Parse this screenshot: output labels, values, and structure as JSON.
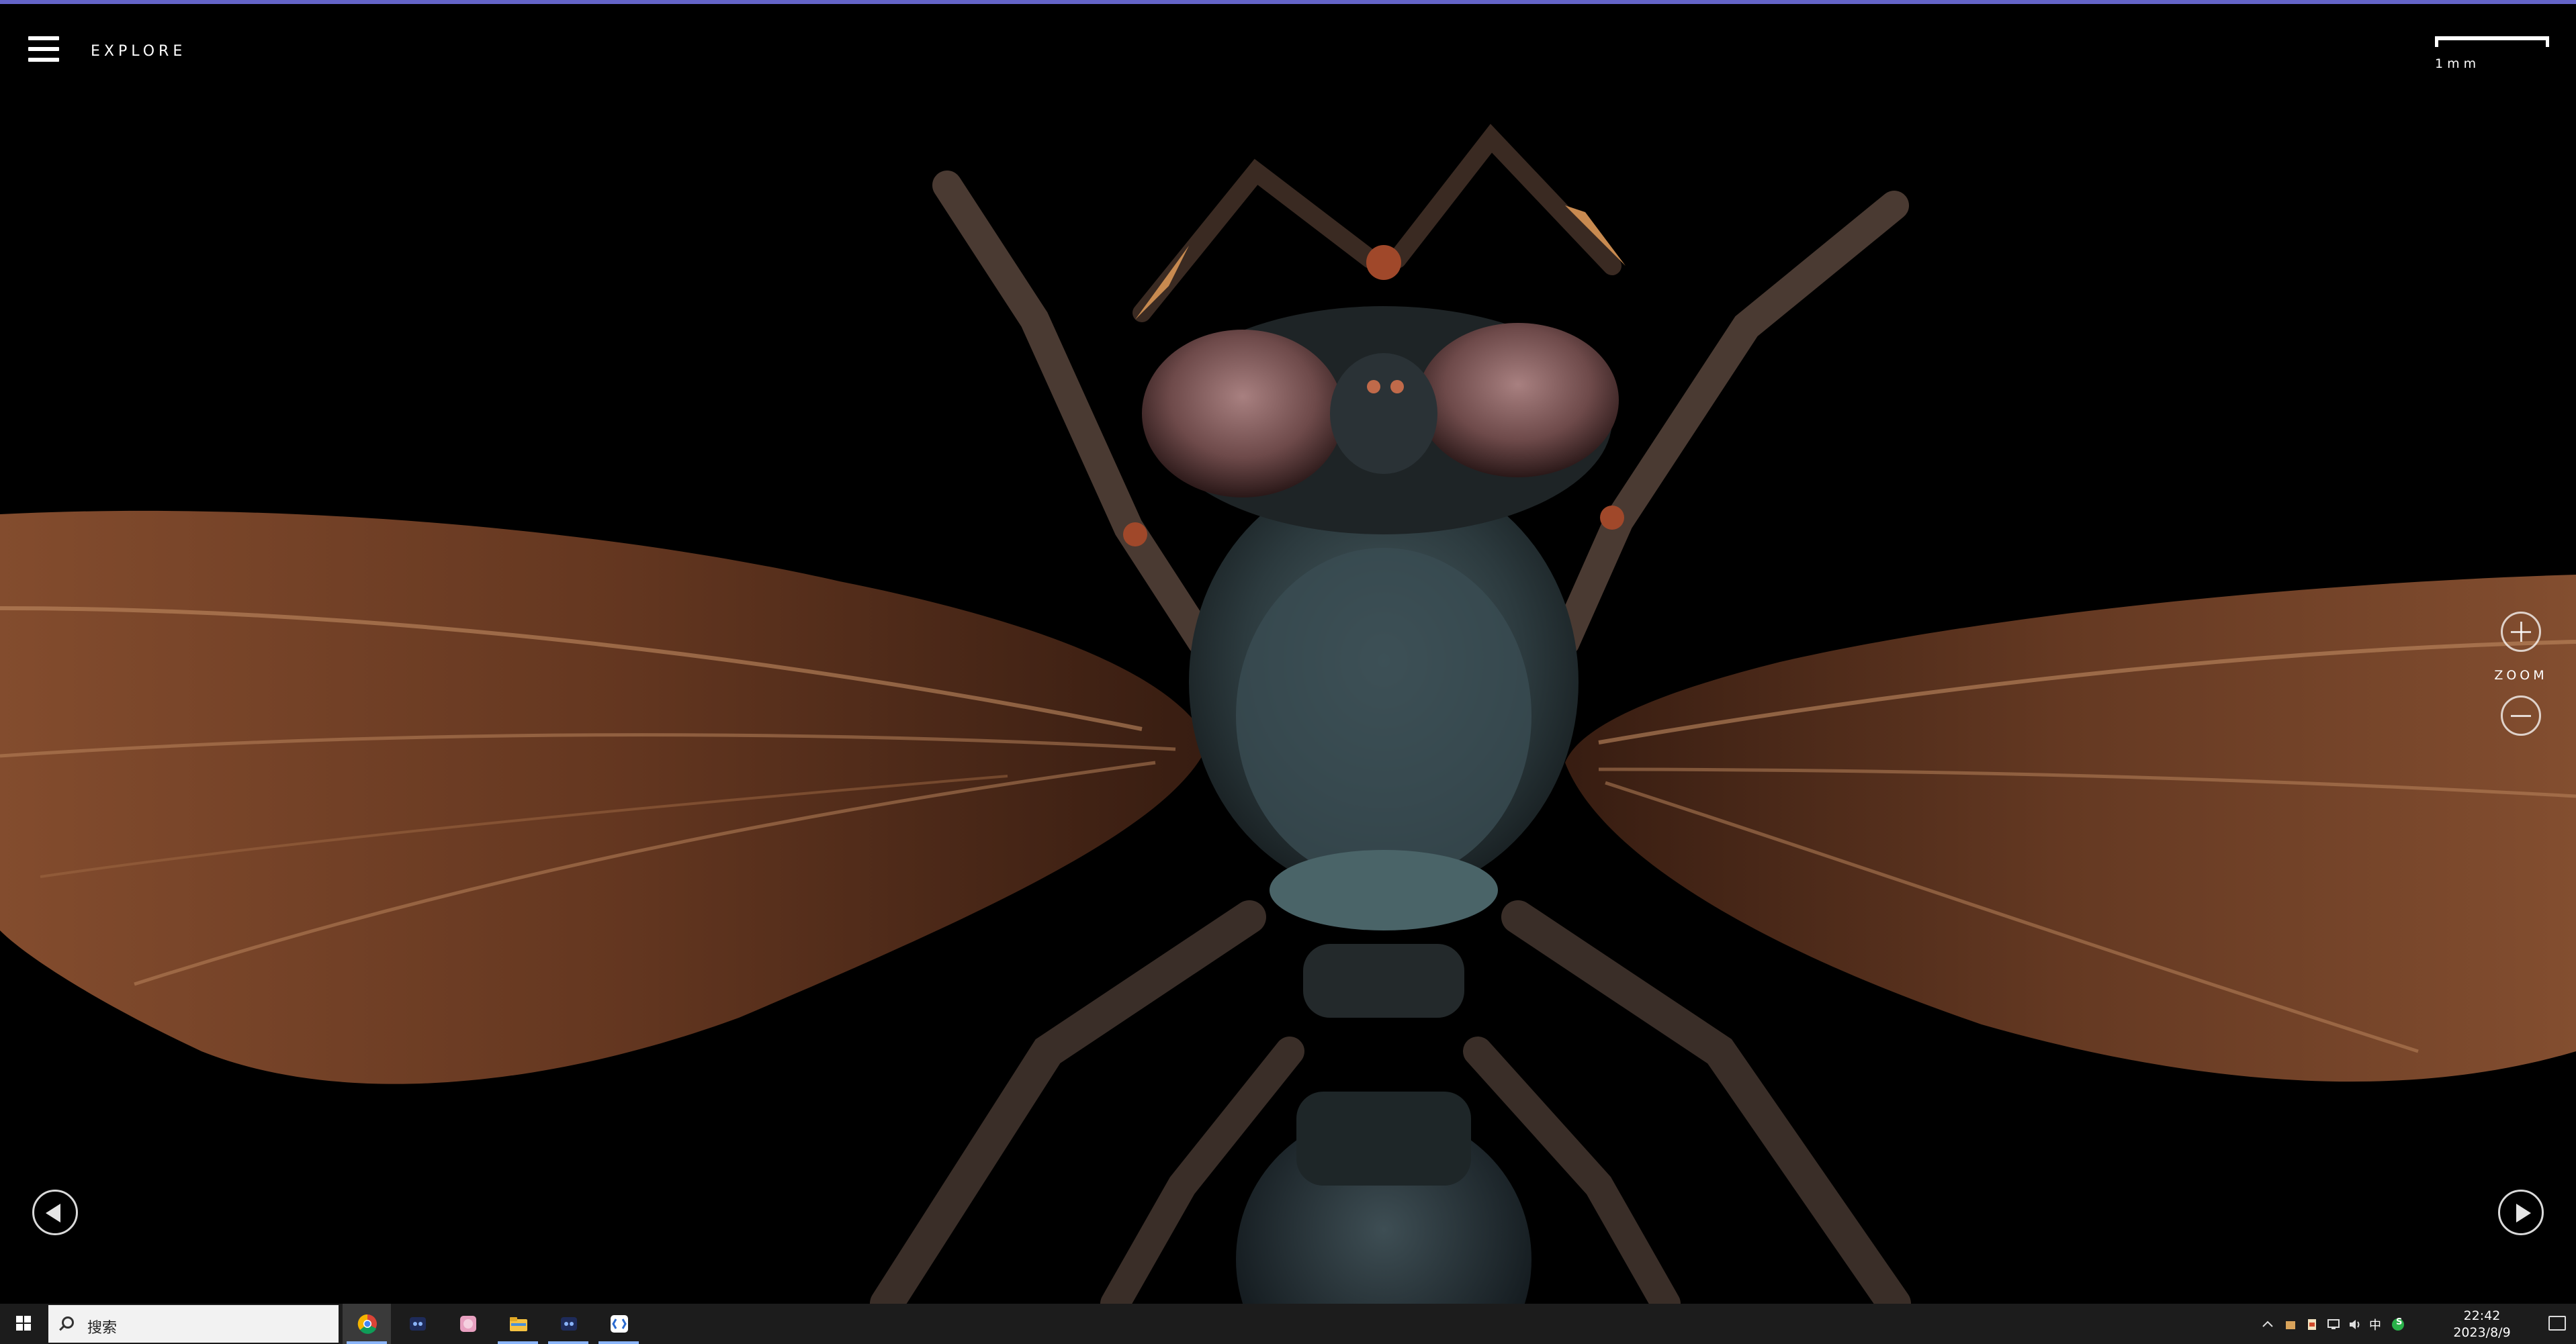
{
  "header": {
    "explore_label": "EXPLORE",
    "menu_icon": "hamburger-menu-icon"
  },
  "scale": {
    "label": "1mm"
  },
  "zoom": {
    "label": "ZOOM",
    "zoom_in_icon": "plus-icon",
    "zoom_out_icon": "minus-icon"
  },
  "nav": {
    "prev_icon": "arrow-left-icon",
    "next_icon": "arrow-right-icon"
  },
  "taskbar": {
    "search_placeholder": "搜索",
    "apps": [
      {
        "name": "chrome",
        "icon": "chrome-icon",
        "active": true
      },
      {
        "name": "app-blue-1",
        "icon": "app-icon"
      },
      {
        "name": "app-pink",
        "icon": "app-icon"
      },
      {
        "name": "file-explorer",
        "icon": "folder-icon"
      },
      {
        "name": "app-blue-2",
        "icon": "app-icon"
      },
      {
        "name": "app-bracket",
        "icon": "app-icon"
      }
    ],
    "tray": {
      "time": "22:42",
      "date": "2023/8/9",
      "ime": "中",
      "ime_mode": "S"
    }
  },
  "colors": {
    "top_accent": "#6464c8",
    "background": "#000000",
    "taskbar": "#1c1c1c"
  }
}
